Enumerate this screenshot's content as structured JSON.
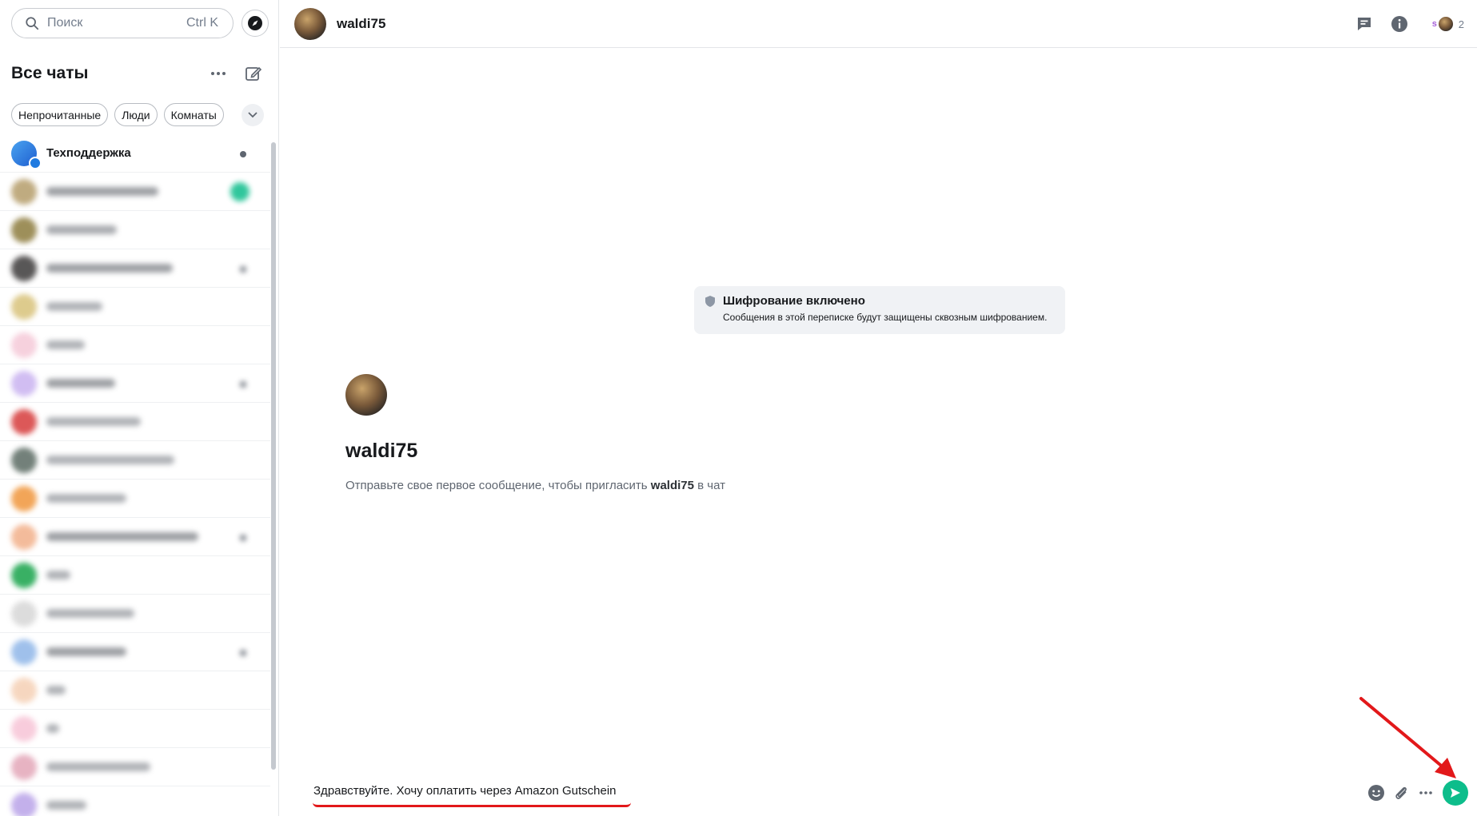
{
  "search": {
    "placeholder": "Поиск",
    "shortcut": "Ctrl K"
  },
  "sidebar": {
    "title": "Все чаты",
    "filters": [
      "Непрочитанные",
      "Люди",
      "Комнаты"
    ],
    "rooms": [
      {
        "name": "Техподдержка",
        "visible": true
      }
    ]
  },
  "room": {
    "name": "waldi75",
    "member_count": "2",
    "member_initial": "s"
  },
  "encryption": {
    "title": "Шифрование включено",
    "subtitle": "Сообщения в этой переписке будут защищены сквозным шифрованием."
  },
  "intro": {
    "name": "waldi75",
    "text_before": "Отправьте свое первое сообщение, чтобы пригласить ",
    "text_user": "waldi75",
    "text_after": " в чат"
  },
  "composer": {
    "value": "Здравствуйте. Хочу оплатить через Amazon Gutschein"
  },
  "colors": {
    "accent": "#0dbd8b",
    "annotation": "#e2181a"
  },
  "icons": {
    "search": "search-icon",
    "explore": "compass-icon",
    "options": "ellipsis-icon",
    "compose": "compose-icon",
    "threads": "threads-icon",
    "info": "info-icon",
    "shield": "shield-icon",
    "emoji": "emoji-icon",
    "attach": "paperclip-icon",
    "more": "ellipsis-icon",
    "send": "send-icon"
  }
}
